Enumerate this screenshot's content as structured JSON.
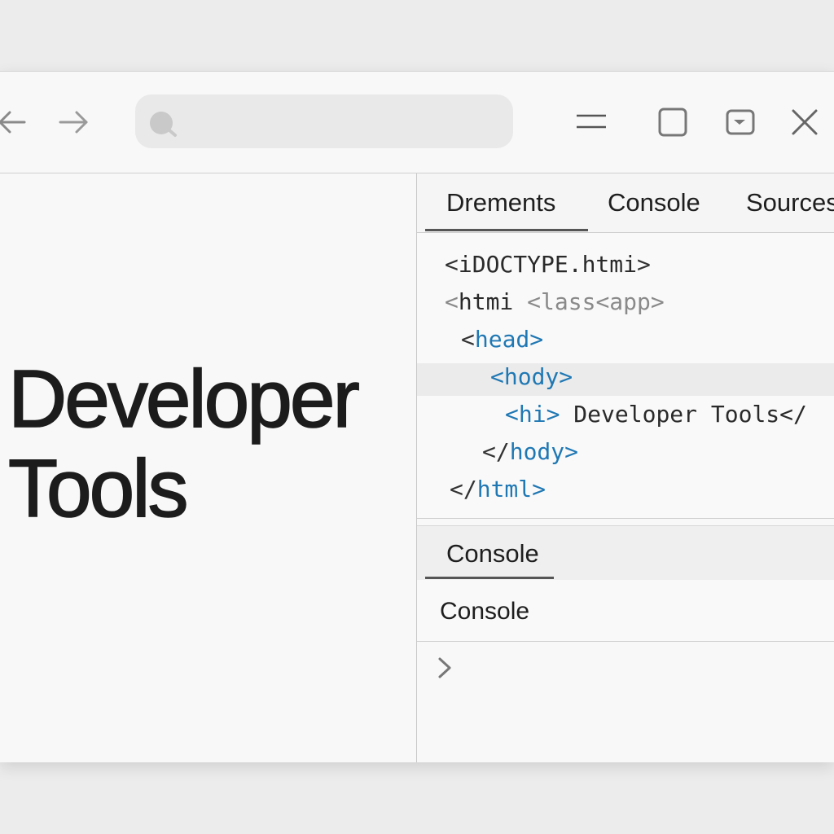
{
  "toolbar": {
    "back_icon": "arrow-left-icon",
    "forward_icon": "arrow-right-icon",
    "search": {
      "icon": "search-icon",
      "value": ""
    },
    "window_controls": [
      "menu-icon",
      "maximize-icon",
      "picture-in-picture-icon",
      "close-icon"
    ]
  },
  "page": {
    "title_line1": "Developer",
    "title_line2": "Tools"
  },
  "devtools": {
    "tabs": [
      {
        "label": "Drements",
        "active": true
      },
      {
        "label": "Console",
        "active": false
      },
      {
        "label": "Sources",
        "active": false
      }
    ],
    "elements": [
      {
        "open": "<",
        "name": "iDOCTYPE.htmi",
        "close": ">"
      },
      {
        "open": "<",
        "name": "htmi",
        "attr": "<lass<app>"
      },
      {
        "open": "<",
        "name": "head",
        "close": ">"
      },
      {
        "open": "<",
        "name": "hody",
        "close": ">"
      },
      {
        "open": "<",
        "name": "hi",
        "close": ">",
        "text": "Developer Tools</"
      },
      {
        "open": "</",
        "name": "hody",
        "close": ">"
      },
      {
        "open": "</",
        "name": "html",
        "close": ">"
      }
    ],
    "console_tab_label": "Console",
    "console_header_label": "Console",
    "prompt_icon": "chevron-right-icon"
  },
  "colors": {
    "tag": "#1f78b4",
    "background": "#f8f8f8",
    "text": "#1c1c1c"
  }
}
